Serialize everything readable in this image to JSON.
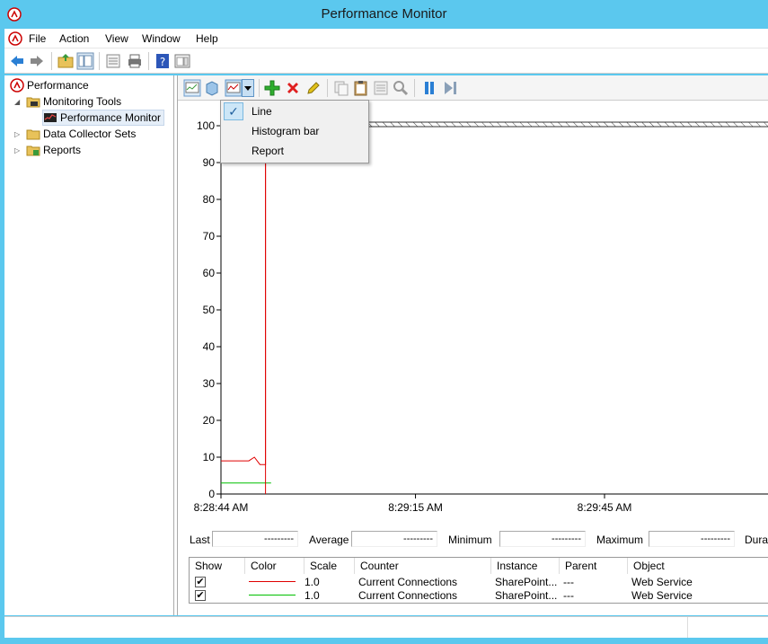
{
  "window": {
    "title": "Performance Monitor"
  },
  "menu": [
    "File",
    "Action",
    "View",
    "Window",
    "Help"
  ],
  "tree": {
    "root": "Performance",
    "monitoring_tools": "Monitoring Tools",
    "performance_monitor": "Performance Monitor",
    "data_collector_sets": "Data Collector Sets",
    "reports": "Reports"
  },
  "graph_type_menu": {
    "items": [
      {
        "label": "Line",
        "checked": true
      },
      {
        "label": "Histogram bar",
        "checked": false
      },
      {
        "label": "Report",
        "checked": false
      }
    ],
    "check_glyph": "✓"
  },
  "chart_data": {
    "type": "line",
    "ylim": [
      0,
      100
    ],
    "yticks": [
      "0",
      "10",
      "20",
      "30",
      "40",
      "50",
      "60",
      "70",
      "80",
      "90",
      "100"
    ],
    "xticks": [
      "8:28:44 AM",
      "8:29:15 AM",
      "8:29:45 AM"
    ],
    "series": [
      {
        "color": "#e00000",
        "values": [
          9,
          9,
          9,
          9,
          9,
          9,
          10,
          8,
          8,
          100
        ]
      },
      {
        "color": "#00c000",
        "values": [
          3,
          3,
          3,
          3,
          3,
          3,
          3,
          3,
          3,
          3
        ]
      }
    ]
  },
  "stats": {
    "last_label": "Last",
    "last_value": "---------",
    "average_label": "Average",
    "average_value": "---------",
    "minimum_label": "Minimum",
    "minimum_value": "---------",
    "maximum_label": "Maximum",
    "maximum_value": "---------",
    "duration_label": "Dura"
  },
  "legend": {
    "headers": {
      "show": "Show",
      "color": "Color",
      "scale": "Scale",
      "counter": "Counter",
      "instance": "Instance",
      "parent": "Parent",
      "object": "Object"
    },
    "rows": [
      {
        "checked": "✔",
        "color": "#e00000",
        "scale": "1.0",
        "counter": "Current Connections",
        "instance": "SharePoint...",
        "parent": "---",
        "object": "Web Service"
      },
      {
        "checked": "✔",
        "color": "#00c000",
        "scale": "1.0",
        "counter": "Current Connections",
        "instance": "SharePoint...",
        "parent": "---",
        "object": "Web Service"
      }
    ]
  }
}
